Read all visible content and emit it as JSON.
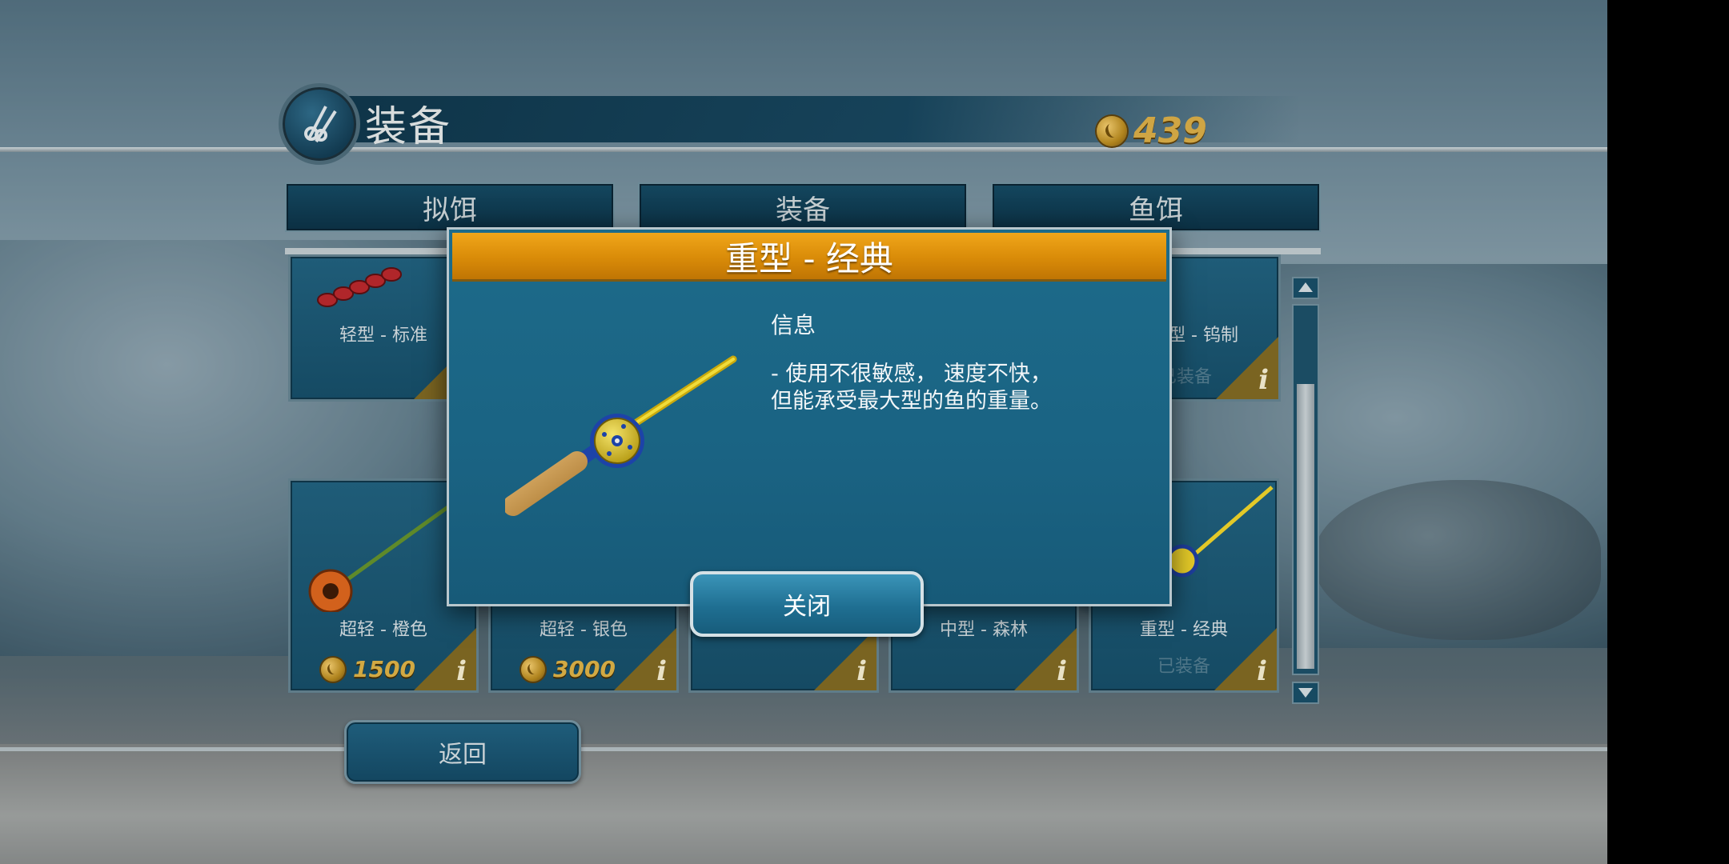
{
  "header": {
    "title": "装备",
    "coins": "439",
    "icon": "fishing-gear-icon"
  },
  "tabs": [
    {
      "label": "拟饵"
    },
    {
      "label": "装备"
    },
    {
      "label": "鱼饵"
    }
  ],
  "grid": {
    "row1": [
      {
        "label": "轻型 - 标准"
      },
      {
        "label": "型 - 钨制",
        "status": "已装备"
      }
    ],
    "row2": [
      {
        "label": "超轻 - 橙色",
        "price": "1500"
      },
      {
        "label": "超轻 - 银色",
        "price": "3000"
      },
      {
        "label": "中型 - 森林"
      },
      {
        "label": "重型 - 经典",
        "status": "已装备"
      }
    ],
    "info_glyph": "i"
  },
  "back_label": "返回",
  "modal": {
    "title": "重型 - 经典",
    "info_heading": "信息",
    "description_line1": "- 使用不很敏感， 速度不快，",
    "description_line2": "但能承受最大型的鱼的重量。",
    "close_label": "关闭"
  },
  "colors": {
    "accent_orange": "#e39a10",
    "panel_blue": "#1b6685",
    "coin_gold": "#cfa544"
  }
}
